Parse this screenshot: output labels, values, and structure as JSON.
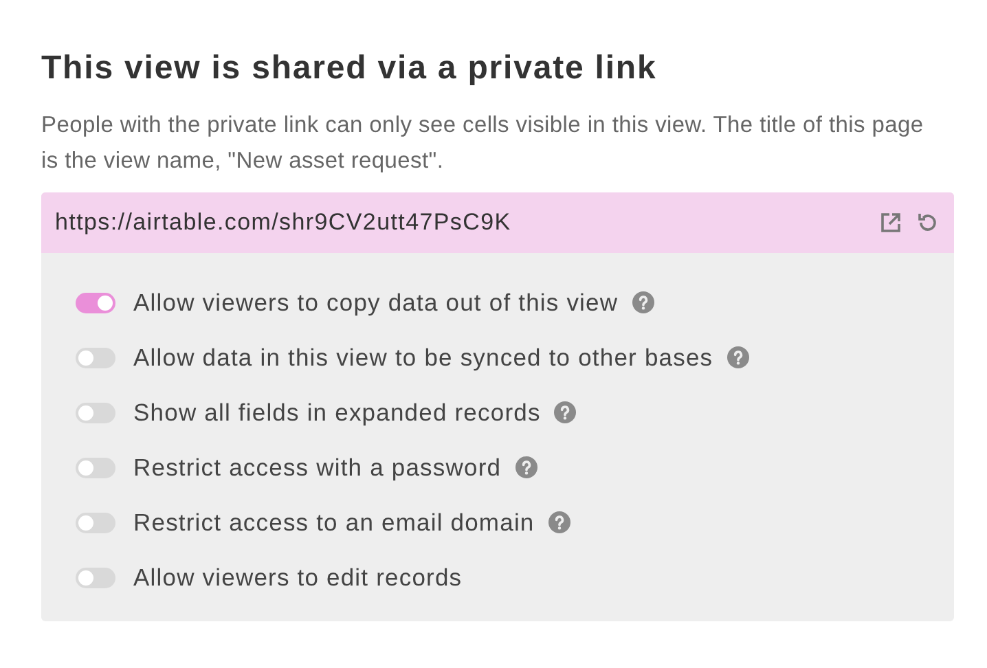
{
  "title": "This view is shared via a private link",
  "description": "People with the private link can only see cells visible in this view. The title of this page is the view name, \"New asset request\".",
  "link": {
    "url": "https://airtable.com/shr9CV2utt47PsC9K"
  },
  "options": [
    {
      "label": "Allow viewers to copy data out of this view",
      "on": true,
      "help": true
    },
    {
      "label": "Allow data in this view to be synced to other bases",
      "on": false,
      "help": true
    },
    {
      "label": "Show all fields in expanded records",
      "on": false,
      "help": true
    },
    {
      "label": "Restrict access with a password",
      "on": false,
      "help": true
    },
    {
      "label": "Restrict access to an email domain",
      "on": false,
      "help": true
    },
    {
      "label": "Allow viewers to edit records",
      "on": false,
      "help": false
    }
  ]
}
